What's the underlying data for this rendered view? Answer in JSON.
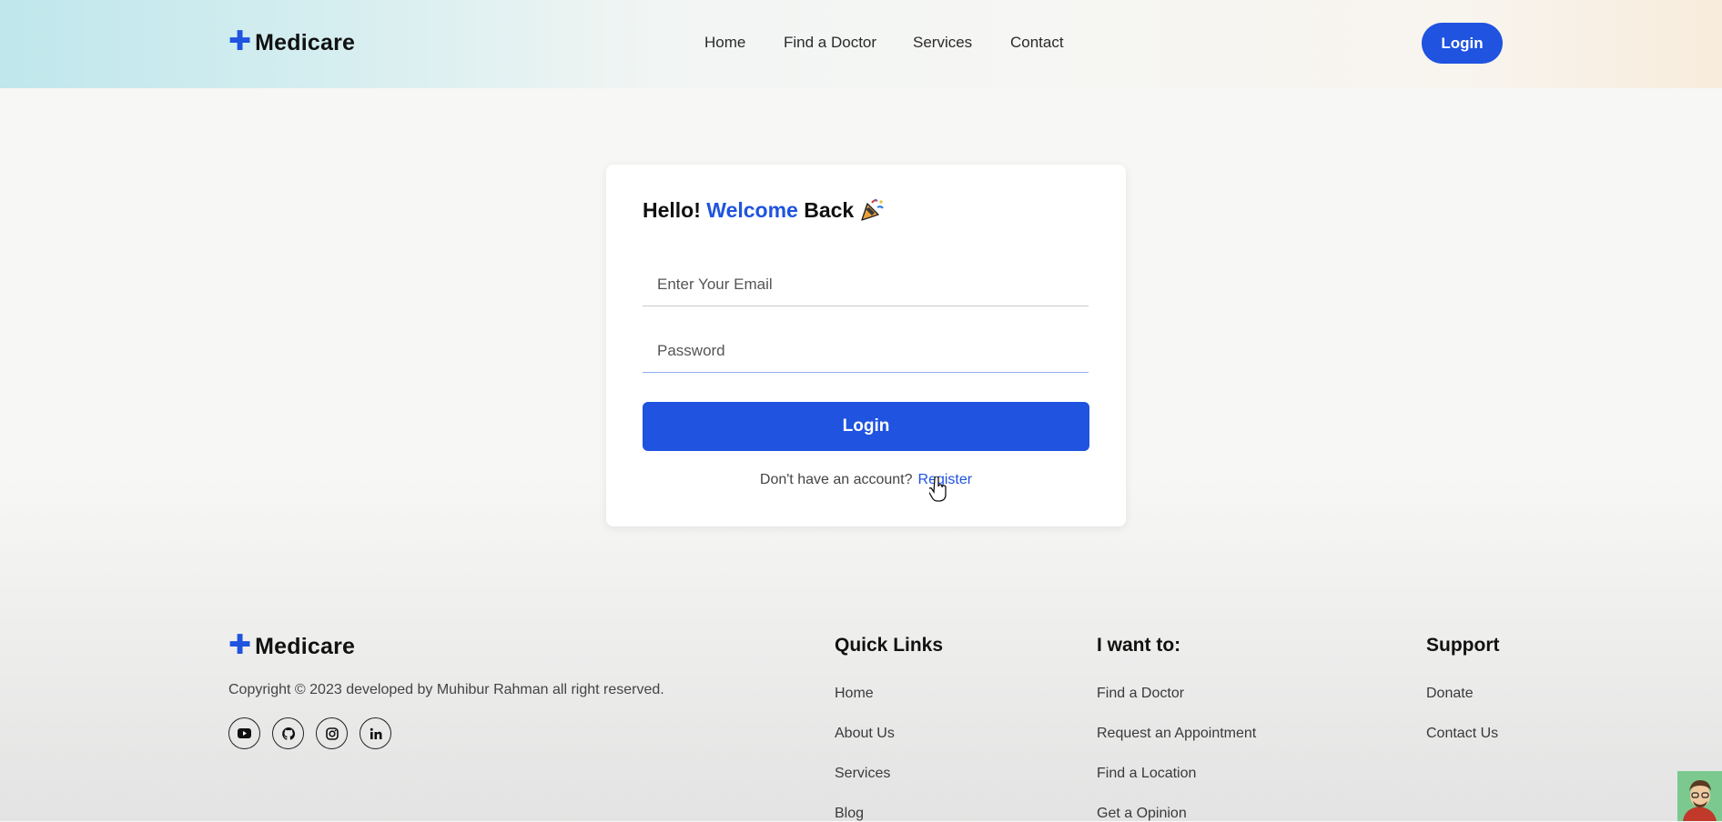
{
  "brand": {
    "name": "Medicare",
    "plus": "✚"
  },
  "nav": {
    "items": [
      "Home",
      "Find a Doctor",
      "Services",
      "Contact"
    ],
    "login_label": "Login"
  },
  "login_card": {
    "title_prefix": "Hello! ",
    "title_highlight": "Welcome",
    "title_suffix": " Back",
    "email_placeholder": "Enter Your Email",
    "password_placeholder": "Password",
    "submit_label": "Login",
    "no_account_text": "Don't have an account?",
    "register_label": "Register"
  },
  "footer": {
    "copyright": "Copyright © 2023 developed by Muhibur Rahman all right reserved.",
    "social_icons": [
      "youtube-icon",
      "github-icon",
      "instagram-icon",
      "linkedin-icon"
    ],
    "quick_links": {
      "title": "Quick Links",
      "items": [
        "Home",
        "About Us",
        "Services",
        "Blog"
      ]
    },
    "i_want_to": {
      "title": "I want to:",
      "items": [
        "Find a Doctor",
        "Request an Appointment",
        "Find a Location",
        "Get a Opinion"
      ]
    },
    "support": {
      "title": "Support",
      "items": [
        "Donate",
        "Contact Us"
      ]
    }
  },
  "colors": {
    "accent": "#1f53e0"
  }
}
